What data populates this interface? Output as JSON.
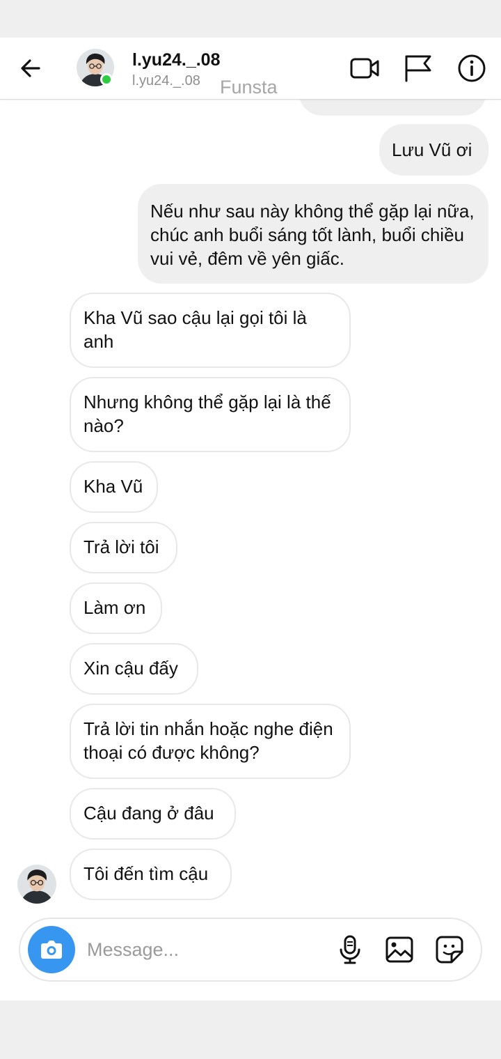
{
  "header": {
    "title": "l.yu24._.08",
    "subtitle": "l.yu24._.08",
    "watermark": "Funsta",
    "online_color": "#2ecc40"
  },
  "messages": [
    {
      "from": "me",
      "text": "Lưu Vũ ơi"
    },
    {
      "from": "me",
      "text": "Nếu như sau này không thể gặp lại nữa, chúc anh buổi sáng tốt lành, buổi chiều vui vẻ, đêm về yên giấc."
    },
    {
      "from": "them",
      "text": "Kha Vũ sao cậu lại gọi tôi là anh"
    },
    {
      "from": "them",
      "text": "Nhưng không thể gặp lại là thế nào?"
    },
    {
      "from": "them",
      "text": "Kha Vũ"
    },
    {
      "from": "them",
      "text": "Trả lời tôi"
    },
    {
      "from": "them",
      "text": "Làm ơn"
    },
    {
      "from": "them",
      "text": "Xin cậu đấy"
    },
    {
      "from": "them",
      "text": "Trả lời tin nhắn hoặc nghe điện thoại có được không?"
    },
    {
      "from": "them",
      "text": "Cậu đang ở đâu"
    },
    {
      "from": "them",
      "text": "Tôi đến tìm cậu"
    }
  ],
  "composer": {
    "placeholder": "Message...",
    "accent": "#3797f0"
  },
  "icons": {
    "back": "arrow-left-icon",
    "video": "video-camera-icon",
    "flag": "flag-icon",
    "info": "info-icon",
    "camera": "camera-icon",
    "mic": "microphone-icon",
    "gallery": "image-icon",
    "sticker": "sticker-icon"
  }
}
